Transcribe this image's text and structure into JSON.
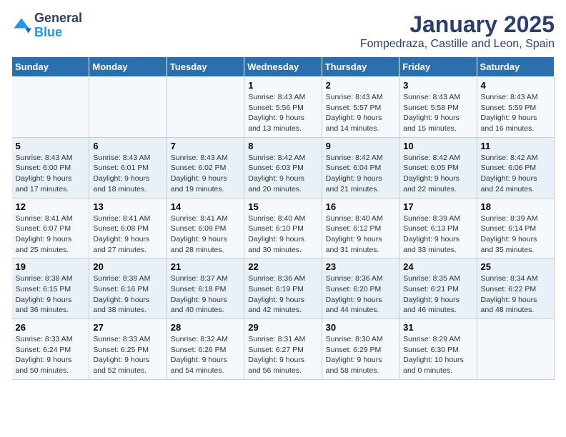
{
  "logo": {
    "general": "General",
    "blue": "Blue"
  },
  "header": {
    "month": "January 2025",
    "location": "Fompedraza, Castille and Leon, Spain"
  },
  "weekdays": [
    "Sunday",
    "Monday",
    "Tuesday",
    "Wednesday",
    "Thursday",
    "Friday",
    "Saturday"
  ],
  "weeks": [
    [
      {
        "day": "",
        "info": ""
      },
      {
        "day": "",
        "info": ""
      },
      {
        "day": "",
        "info": ""
      },
      {
        "day": "1",
        "info": "Sunrise: 8:43 AM\nSunset: 5:56 PM\nDaylight: 9 hours and 13 minutes."
      },
      {
        "day": "2",
        "info": "Sunrise: 8:43 AM\nSunset: 5:57 PM\nDaylight: 9 hours and 14 minutes."
      },
      {
        "day": "3",
        "info": "Sunrise: 8:43 AM\nSunset: 5:58 PM\nDaylight: 9 hours and 15 minutes."
      },
      {
        "day": "4",
        "info": "Sunrise: 8:43 AM\nSunset: 5:59 PM\nDaylight: 9 hours and 16 minutes."
      }
    ],
    [
      {
        "day": "5",
        "info": "Sunrise: 8:43 AM\nSunset: 6:00 PM\nDaylight: 9 hours and 17 minutes."
      },
      {
        "day": "6",
        "info": "Sunrise: 8:43 AM\nSunset: 6:01 PM\nDaylight: 9 hours and 18 minutes."
      },
      {
        "day": "7",
        "info": "Sunrise: 8:43 AM\nSunset: 6:02 PM\nDaylight: 9 hours and 19 minutes."
      },
      {
        "day": "8",
        "info": "Sunrise: 8:42 AM\nSunset: 6:03 PM\nDaylight: 9 hours and 20 minutes."
      },
      {
        "day": "9",
        "info": "Sunrise: 8:42 AM\nSunset: 6:04 PM\nDaylight: 9 hours and 21 minutes."
      },
      {
        "day": "10",
        "info": "Sunrise: 8:42 AM\nSunset: 6:05 PM\nDaylight: 9 hours and 22 minutes."
      },
      {
        "day": "11",
        "info": "Sunrise: 8:42 AM\nSunset: 6:06 PM\nDaylight: 9 hours and 24 minutes."
      }
    ],
    [
      {
        "day": "12",
        "info": "Sunrise: 8:41 AM\nSunset: 6:07 PM\nDaylight: 9 hours and 25 minutes."
      },
      {
        "day": "13",
        "info": "Sunrise: 8:41 AM\nSunset: 6:08 PM\nDaylight: 9 hours and 27 minutes."
      },
      {
        "day": "14",
        "info": "Sunrise: 8:41 AM\nSunset: 6:09 PM\nDaylight: 9 hours and 28 minutes."
      },
      {
        "day": "15",
        "info": "Sunrise: 8:40 AM\nSunset: 6:10 PM\nDaylight: 9 hours and 30 minutes."
      },
      {
        "day": "16",
        "info": "Sunrise: 8:40 AM\nSunset: 6:12 PM\nDaylight: 9 hours and 31 minutes."
      },
      {
        "day": "17",
        "info": "Sunrise: 8:39 AM\nSunset: 6:13 PM\nDaylight: 9 hours and 33 minutes."
      },
      {
        "day": "18",
        "info": "Sunrise: 8:39 AM\nSunset: 6:14 PM\nDaylight: 9 hours and 35 minutes."
      }
    ],
    [
      {
        "day": "19",
        "info": "Sunrise: 8:38 AM\nSunset: 6:15 PM\nDaylight: 9 hours and 36 minutes."
      },
      {
        "day": "20",
        "info": "Sunrise: 8:38 AM\nSunset: 6:16 PM\nDaylight: 9 hours and 38 minutes."
      },
      {
        "day": "21",
        "info": "Sunrise: 8:37 AM\nSunset: 6:18 PM\nDaylight: 9 hours and 40 minutes."
      },
      {
        "day": "22",
        "info": "Sunrise: 8:36 AM\nSunset: 6:19 PM\nDaylight: 9 hours and 42 minutes."
      },
      {
        "day": "23",
        "info": "Sunrise: 8:36 AM\nSunset: 6:20 PM\nDaylight: 9 hours and 44 minutes."
      },
      {
        "day": "24",
        "info": "Sunrise: 8:35 AM\nSunset: 6:21 PM\nDaylight: 9 hours and 46 minutes."
      },
      {
        "day": "25",
        "info": "Sunrise: 8:34 AM\nSunset: 6:22 PM\nDaylight: 9 hours and 48 minutes."
      }
    ],
    [
      {
        "day": "26",
        "info": "Sunrise: 8:33 AM\nSunset: 6:24 PM\nDaylight: 9 hours and 50 minutes."
      },
      {
        "day": "27",
        "info": "Sunrise: 8:33 AM\nSunset: 6:25 PM\nDaylight: 9 hours and 52 minutes."
      },
      {
        "day": "28",
        "info": "Sunrise: 8:32 AM\nSunset: 6:26 PM\nDaylight: 9 hours and 54 minutes."
      },
      {
        "day": "29",
        "info": "Sunrise: 8:31 AM\nSunset: 6:27 PM\nDaylight: 9 hours and 56 minutes."
      },
      {
        "day": "30",
        "info": "Sunrise: 8:30 AM\nSunset: 6:29 PM\nDaylight: 9 hours and 58 minutes."
      },
      {
        "day": "31",
        "info": "Sunrise: 8:29 AM\nSunset: 6:30 PM\nDaylight: 10 hours and 0 minutes."
      },
      {
        "day": "",
        "info": ""
      }
    ]
  ]
}
